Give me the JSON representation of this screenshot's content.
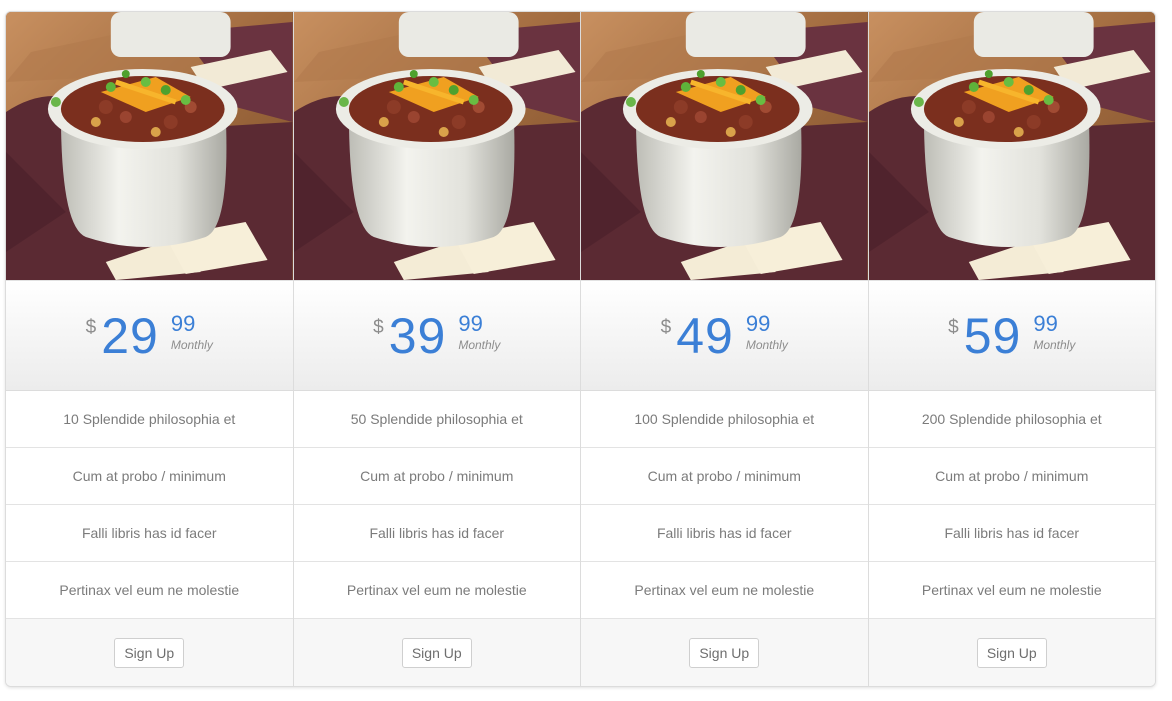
{
  "plans": [
    {
      "currency": "$",
      "amount": "29",
      "cents": "99",
      "period": "Monthly",
      "features": [
        "10 Splendide philosophia et",
        "Cum at probo / minimum",
        "Falli libris has id facer",
        "Pertinax vel eum ne molestie"
      ],
      "button_label": "Sign Up"
    },
    {
      "currency": "$",
      "amount": "39",
      "cents": "99",
      "period": "Monthly",
      "features": [
        "50 Splendide philosophia et",
        "Cum at probo / minimum",
        "Falli libris has id facer",
        "Pertinax vel eum ne molestie"
      ],
      "button_label": "Sign Up"
    },
    {
      "currency": "$",
      "amount": "49",
      "cents": "99",
      "period": "Monthly",
      "features": [
        "100 Splendide philosophia et",
        "Cum at probo / minimum",
        "Falli libris has id facer",
        "Pertinax vel eum ne molestie"
      ],
      "button_label": "Sign Up"
    },
    {
      "currency": "$",
      "amount": "59",
      "cents": "99",
      "period": "Monthly",
      "features": [
        "200 Splendide philosophia et",
        "Cum at probo / minimum",
        "Falli libris has id facer",
        "Pertinax vel eum ne molestie"
      ],
      "button_label": "Sign Up"
    }
  ],
  "image": {
    "subject": "chili-bowl-photo"
  },
  "colors": {
    "price": "#3b7fd6",
    "border": "#dcdcdc",
    "text": "#7b7b7b"
  }
}
